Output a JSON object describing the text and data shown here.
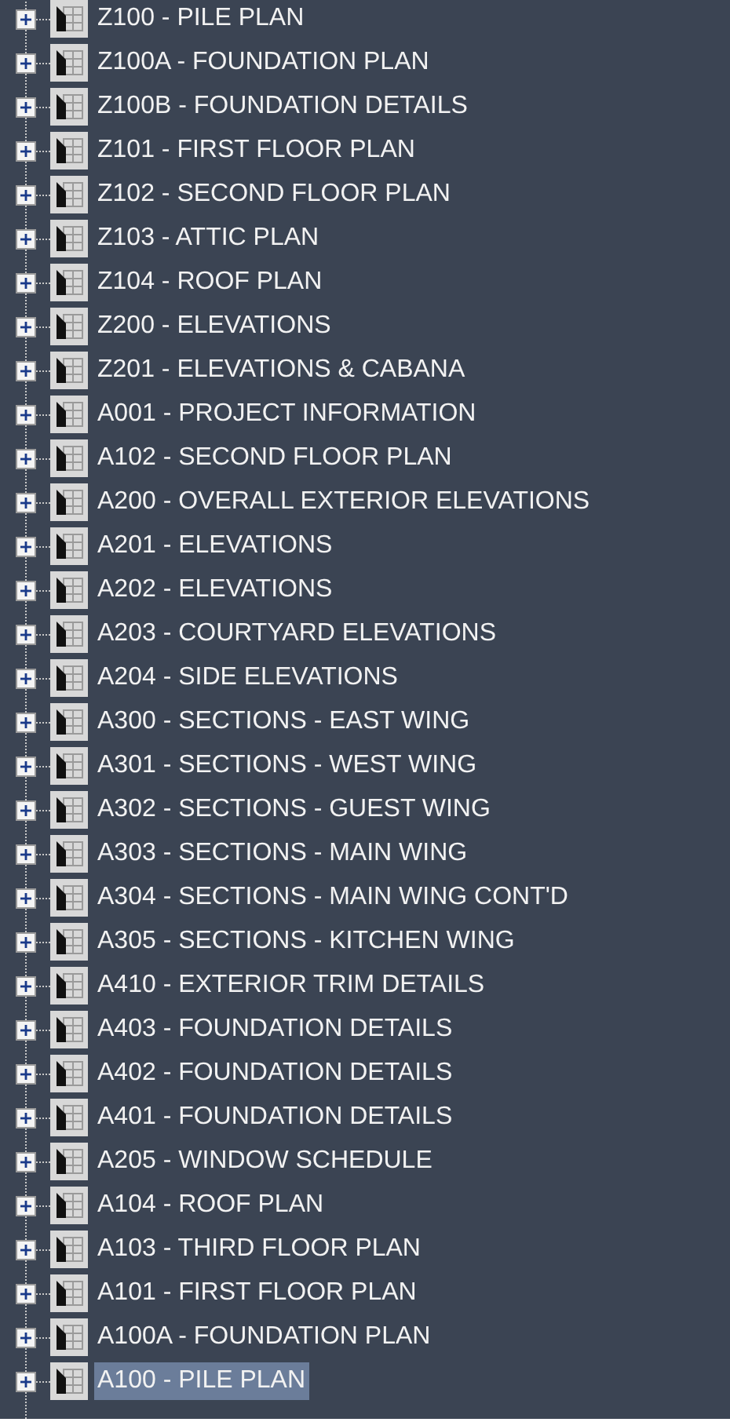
{
  "tree": {
    "items": [
      {
        "label": "Z100 - PILE PLAN",
        "expanded": false,
        "selected": false
      },
      {
        "label": "Z100A - FOUNDATION PLAN",
        "expanded": false,
        "selected": false
      },
      {
        "label": "Z100B - FOUNDATION DETAILS",
        "expanded": false,
        "selected": false
      },
      {
        "label": "Z101 - FIRST FLOOR PLAN",
        "expanded": false,
        "selected": false
      },
      {
        "label": "Z102 - SECOND FLOOR PLAN",
        "expanded": false,
        "selected": false
      },
      {
        "label": "Z103 - ATTIC PLAN",
        "expanded": false,
        "selected": false
      },
      {
        "label": "Z104 - ROOF PLAN",
        "expanded": false,
        "selected": false
      },
      {
        "label": "Z200 - ELEVATIONS",
        "expanded": false,
        "selected": false
      },
      {
        "label": "Z201 - ELEVATIONS & CABANA",
        "expanded": false,
        "selected": false
      },
      {
        "label": "A001 - PROJECT INFORMATION",
        "expanded": false,
        "selected": false
      },
      {
        "label": "A102 - SECOND FLOOR PLAN",
        "expanded": false,
        "selected": false
      },
      {
        "label": "A200 - OVERALL EXTERIOR ELEVATIONS",
        "expanded": false,
        "selected": false
      },
      {
        "label": "A201 - ELEVATIONS",
        "expanded": false,
        "selected": false
      },
      {
        "label": "A202 - ELEVATIONS",
        "expanded": false,
        "selected": false
      },
      {
        "label": "A203 - COURTYARD ELEVATIONS",
        "expanded": false,
        "selected": false
      },
      {
        "label": "A204 - SIDE ELEVATIONS",
        "expanded": false,
        "selected": false
      },
      {
        "label": "A300 - SECTIONS - EAST WING",
        "expanded": false,
        "selected": false
      },
      {
        "label": "A301 - SECTIONS - WEST WING",
        "expanded": false,
        "selected": false
      },
      {
        "label": "A302 - SECTIONS - GUEST WING",
        "expanded": false,
        "selected": false
      },
      {
        "label": "A303 - SECTIONS - MAIN WING",
        "expanded": false,
        "selected": false
      },
      {
        "label": "A304 - SECTIONS - MAIN WING CONT'D",
        "expanded": false,
        "selected": false
      },
      {
        "label": "A305 - SECTIONS - KITCHEN WING",
        "expanded": false,
        "selected": false
      },
      {
        "label": "A410 - EXTERIOR TRIM DETAILS",
        "expanded": false,
        "selected": false
      },
      {
        "label": "A403 - FOUNDATION DETAILS",
        "expanded": false,
        "selected": false
      },
      {
        "label": "A402 - FOUNDATION DETAILS",
        "expanded": false,
        "selected": false
      },
      {
        "label": "A401 - FOUNDATION DETAILS",
        "expanded": false,
        "selected": false
      },
      {
        "label": "A205 - WINDOW SCHEDULE",
        "expanded": false,
        "selected": false
      },
      {
        "label": "A104 - ROOF PLAN",
        "expanded": false,
        "selected": false
      },
      {
        "label": "A103 - THIRD FLOOR PLAN",
        "expanded": false,
        "selected": false
      },
      {
        "label": "A101 - FIRST FLOOR PLAN",
        "expanded": false,
        "selected": false
      },
      {
        "label": "A100A - FOUNDATION PLAN",
        "expanded": false,
        "selected": false
      },
      {
        "label": "A100 - PILE PLAN",
        "expanded": false,
        "selected": true
      }
    ]
  }
}
